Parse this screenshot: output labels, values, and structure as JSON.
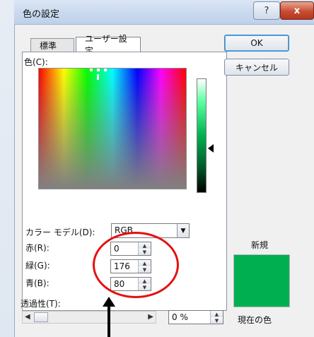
{
  "window": {
    "title": "色の設定",
    "help_icon": "?",
    "close_icon": "x"
  },
  "tabs": [
    {
      "label": "標準"
    },
    {
      "label": "ユーザー設定"
    }
  ],
  "color_label": "色(C):",
  "color_model": {
    "label": "カラー モデル(D):",
    "selected": "RGB",
    "dropdown_icon": "▼"
  },
  "rgb": {
    "red": {
      "label": "赤(R):",
      "value": "0"
    },
    "green": {
      "label": "緑(G):",
      "value": "176"
    },
    "blue": {
      "label": "青(B):",
      "value": "80"
    }
  },
  "buttons": {
    "ok": "OK",
    "cancel": "キャンセル"
  },
  "preview": {
    "new_label": "新規",
    "current_label": "現在の色",
    "color": "#00B050"
  },
  "transparency": {
    "label": "透過性(T):",
    "value": "0 %",
    "level_fraction": 0
  },
  "annotation": {
    "highlight_color": "#E61010",
    "arrow": "up"
  }
}
